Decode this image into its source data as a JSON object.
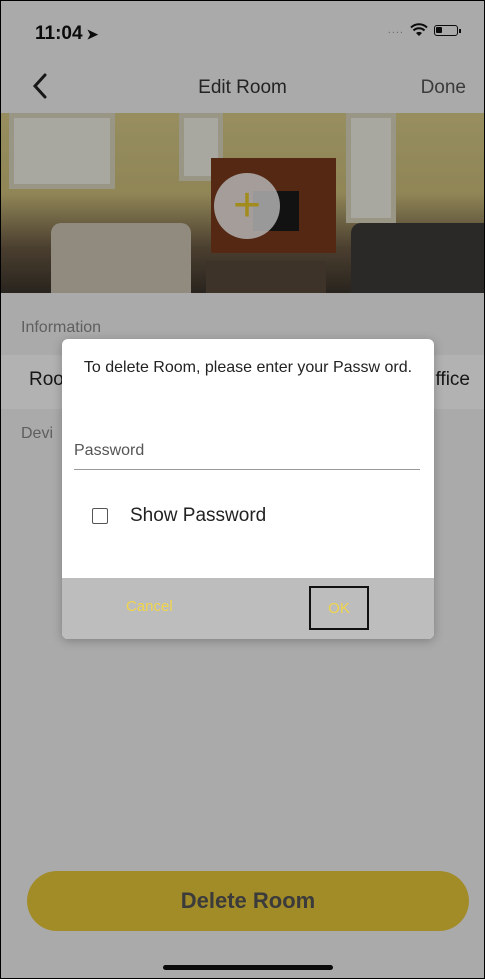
{
  "status_bar": {
    "time": "11:04"
  },
  "nav": {
    "title": "Edit Room",
    "done_label": "Done"
  },
  "sections": {
    "information_label": "Information",
    "room_row_label": "Roo",
    "room_row_value": "ffice",
    "devices_label": "Devi"
  },
  "dialog": {
    "message": "To delete Room, please enter your Passw ord.",
    "password_placeholder": "Password",
    "show_password_label": "Show Password",
    "cancel_label": "Cancel",
    "ok_label": "OK"
  },
  "footer": {
    "delete_label": "Delete Room"
  },
  "colors": {
    "accent": "#e8c93a",
    "dialog_button_text": "#f1d54a"
  }
}
